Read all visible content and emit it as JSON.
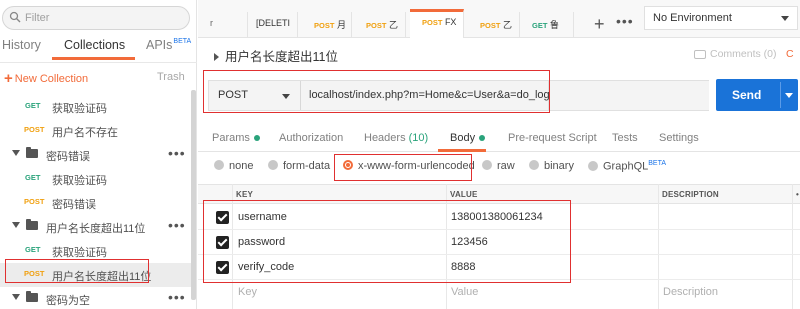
{
  "sidebar": {
    "search_placeholder": "Filter",
    "tabs": [
      {
        "label": "History"
      },
      {
        "label": "Collections"
      },
      {
        "label": "APIs",
        "badge": "BETA"
      }
    ],
    "new_collection": "New Collection",
    "trash": "Trash",
    "items": [
      {
        "method": "GET",
        "label": "获取验证码"
      },
      {
        "method": "POST",
        "label": "用户名不存在"
      },
      {
        "folder": true,
        "label": "密码错误"
      },
      {
        "method": "GET",
        "label": "获取验证码"
      },
      {
        "method": "POST",
        "label": "密码错误"
      },
      {
        "folder": true,
        "label": "用户名长度超出11位"
      },
      {
        "method": "GET",
        "label": "获取验证码"
      },
      {
        "method": "POST",
        "label": "用户名长度超出11位"
      },
      {
        "folder": true,
        "label": "密码为空"
      }
    ]
  },
  "tabs": [
    {
      "label": "r"
    },
    {
      "label": "[DELETI"
    },
    {
      "method": "POST",
      "label": "月"
    },
    {
      "method": "POST",
      "label": "乙"
    },
    {
      "method": "POST",
      "label": "FX"
    },
    {
      "method": "POST",
      "label": "乙"
    },
    {
      "method": "GET",
      "label": "鲁"
    }
  ],
  "environment": "No Environment",
  "request": {
    "title": "用户名长度超出11位",
    "comments": "Comments (0)",
    "code": "C",
    "method": "POST",
    "url": "localhost/index.php?m=Home&c=User&a=do_login",
    "send": "Send"
  },
  "request_tabs": [
    {
      "label": "Params"
    },
    {
      "label": "Authorization"
    },
    {
      "label": "Headers",
      "count": "(10)"
    },
    {
      "label": "Body"
    },
    {
      "label": "Pre-request Script"
    },
    {
      "label": "Tests"
    },
    {
      "label": "Settings"
    }
  ],
  "body_types": [
    {
      "label": "none"
    },
    {
      "label": "form-data"
    },
    {
      "label": "x-www-form-urlencoded"
    },
    {
      "label": "raw"
    },
    {
      "label": "binary"
    },
    {
      "label": "GraphQL",
      "badge": "BETA"
    }
  ],
  "kv_headers": {
    "key": "KEY",
    "value": "VALUE",
    "description": "DESCRIPTION",
    "more": "•"
  },
  "params": [
    {
      "key": "username",
      "value": "138001380061234"
    },
    {
      "key": "password",
      "value": "123456"
    },
    {
      "key": "verify_code",
      "value": "8888"
    }
  ],
  "placeholders": {
    "key": "Key",
    "value": "Value",
    "description": "Description"
  },
  "colors": {
    "accent": "#f26b3a",
    "send": "#1a73d8",
    "get": "#2aa37b",
    "post": "#f0a010",
    "annotation": "#e03030"
  }
}
